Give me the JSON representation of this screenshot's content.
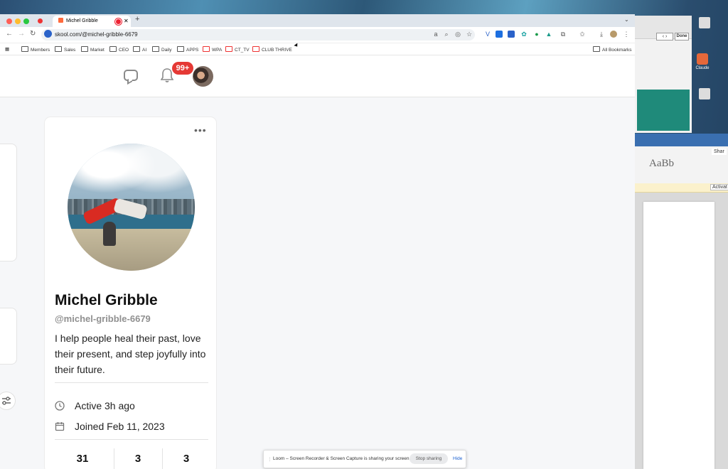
{
  "browser": {
    "tab_title": "Michel Gribble",
    "url": "skool.com/@michel-gribble-6679",
    "bookmarks": [
      "Members",
      "Sales",
      "Market",
      "CEO",
      "AI",
      "Daily",
      "APPS",
      "WPA",
      "CT_TV",
      "CLUB THRIVE"
    ],
    "all_bookmarks": "All Bookmarks"
  },
  "header": {
    "notification_count": "99+"
  },
  "profile": {
    "name": "Michel Gribble",
    "handle": "@michel-gribble-6679",
    "bio": "I help people heal their past, love their present, and step joyfully into their future.",
    "active": "Active 3h ago",
    "joined": "Joined Feb 11, 2023",
    "stats": [
      "31",
      "3",
      "3"
    ]
  },
  "loom": {
    "message": "Loom – Screen Recorder & Screen Capture is sharing your screen.",
    "stop_label": "Stop sharing",
    "hide_label": "Hide"
  },
  "background": {
    "word_style_sample": "AaBb",
    "word_share": "Shar",
    "word_activate": "Activat",
    "preview_done": "Done",
    "desktop_icons": [
      "Claude"
    ]
  },
  "colors": {
    "badge": "#e53935",
    "link": "#1a5fd0",
    "site_icon": "#2a62c9"
  }
}
